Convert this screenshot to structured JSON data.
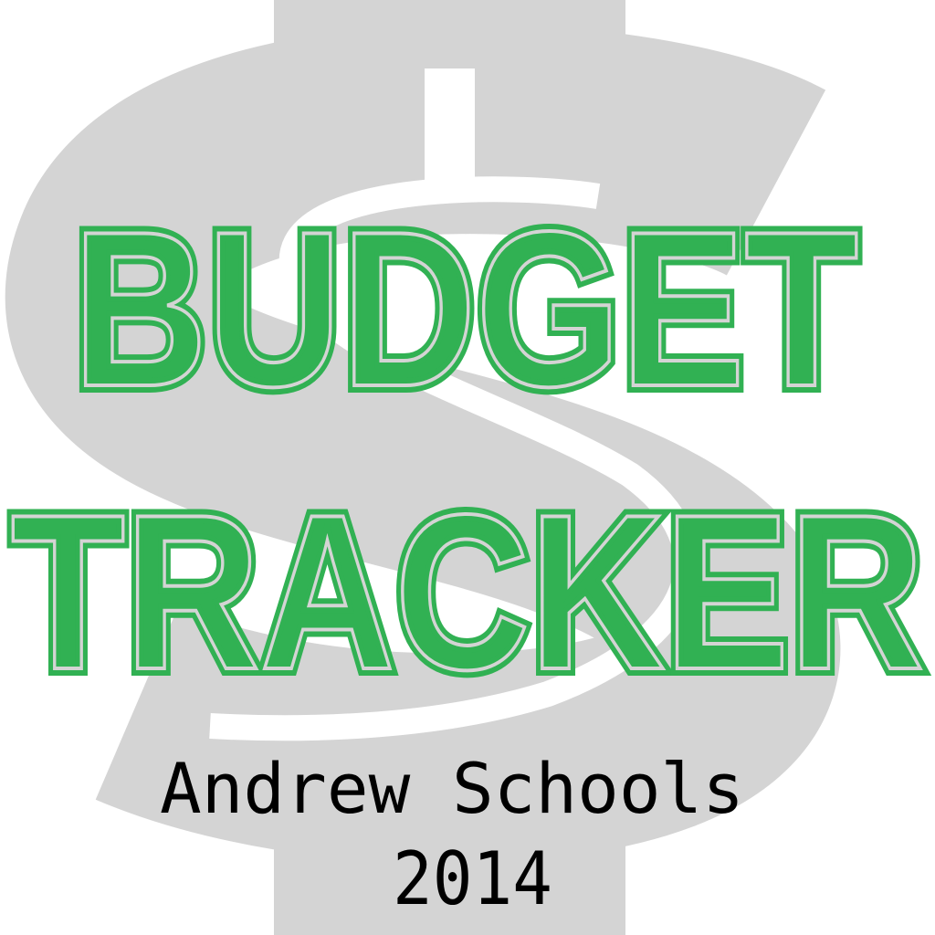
{
  "logo": {
    "line1": "BUDGET",
    "line2": "TRACKER",
    "subtitle": "Andrew Schools",
    "year": "2014",
    "icon": "dollar-sign-icon"
  },
  "colors": {
    "green": "#31b153",
    "gray": "#d4d4d4",
    "text": "#000000"
  }
}
